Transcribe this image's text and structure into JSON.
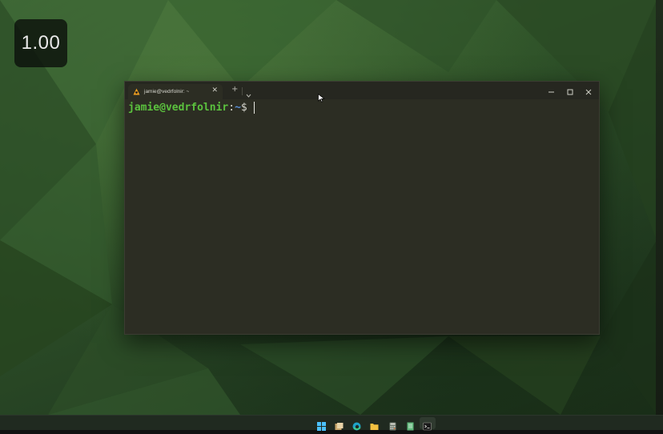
{
  "zoom": {
    "value": "1.00"
  },
  "terminal": {
    "tab": {
      "title": "jamie@vedrfolnir: ~",
      "close_glyph": "✕",
      "icon": "linux-penguin-icon"
    },
    "new_tab_glyph": "+",
    "window_controls": {
      "minimize": "minimize-icon",
      "maximize": "maximize-icon",
      "close": "close-icon"
    },
    "prompt": {
      "user_host": "jamie@vedrfolnir",
      "colon": ":",
      "path": "~",
      "symbol": "$"
    }
  },
  "taskbar": {
    "icons": [
      "start-icon",
      "file-explorer-icon",
      "edge-icon",
      "folder-icon",
      "calculator-icon",
      "notepad-icon",
      "terminal-icon"
    ]
  },
  "colors": {
    "desktop": "#2f5329",
    "terminal_bg": "#2c2d23",
    "prompt_user": "#5bc23e",
    "prompt_path": "#5a8fd6",
    "taskbar_bg": "#202a20"
  }
}
